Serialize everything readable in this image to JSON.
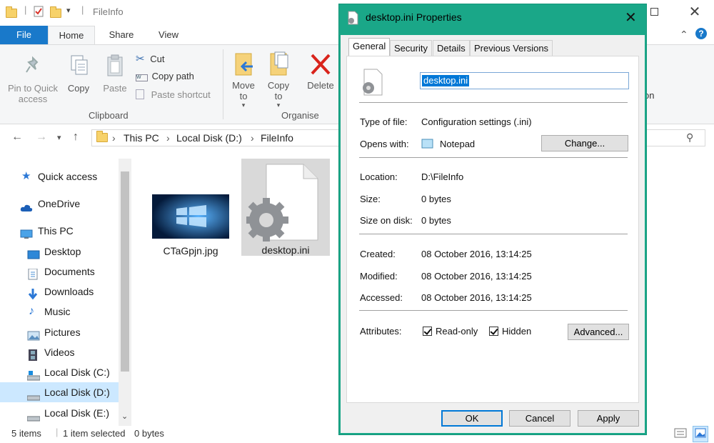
{
  "explorer": {
    "title": "FileInfo",
    "tabs": {
      "file": "File",
      "home": "Home",
      "share": "Share",
      "view": "View"
    },
    "ribbon": {
      "pin": "Pin to Quick access",
      "copy": "Copy",
      "paste": "Paste",
      "cut": "Cut",
      "copy_path": "Copy path",
      "paste_shortcut": "Paste shortcut",
      "clipboard_group": "Clipboard",
      "move_to": "Move to",
      "copy_to": "Copy to",
      "delete": "Delete",
      "organise_group": "Organise",
      "partial_right": "on"
    },
    "address": {
      "crumbs": [
        "This PC",
        "Local Disk (D:)",
        "FileInfo"
      ]
    },
    "nav": {
      "quick_access": "Quick access",
      "onedrive": "OneDrive",
      "this_pc": "This PC",
      "desktop": "Desktop",
      "documents": "Documents",
      "downloads": "Downloads",
      "music": "Music",
      "pictures": "Pictures",
      "videos": "Videos",
      "disk_c": "Local Disk (C:)",
      "disk_d": "Local Disk (D:)",
      "disk_e": "Local Disk (E:)"
    },
    "files": [
      {
        "name": "CTaGpjn.jpg"
      },
      {
        "name": "desktop.ini"
      }
    ],
    "status": {
      "items": "5 items",
      "selected": "1 item selected",
      "size": "0 bytes"
    }
  },
  "dialog": {
    "title": "desktop.ini Properties",
    "tabs": [
      "General",
      "Security",
      "Details",
      "Previous Versions"
    ],
    "filename": "desktop.ini",
    "type_label": "Type of file:",
    "type_value": "Configuration settings (.ini)",
    "opens_label": "Opens with:",
    "opens_value": "Notepad",
    "change_btn": "Change...",
    "location_label": "Location:",
    "location_value": "D:\\FileInfo",
    "size_label": "Size:",
    "size_value": "0 bytes",
    "size_disk_label": "Size on disk:",
    "size_disk_value": "0 bytes",
    "created_label": "Created:",
    "created_value": "08 October 2016, 13:14:25",
    "modified_label": "Modified:",
    "modified_value": "08 October 2016, 13:14:25",
    "accessed_label": "Accessed:",
    "accessed_value": "08 October 2016, 13:14:25",
    "attributes_label": "Attributes:",
    "readonly_label": "Read-only",
    "hidden_label": "Hidden",
    "advanced_btn": "Advanced...",
    "ok_btn": "OK",
    "cancel_btn": "Cancel",
    "apply_btn": "Apply"
  },
  "colors": {
    "accent": "#1979ca",
    "dialog_frame": "#1aa788",
    "selection": "#0078d7"
  }
}
